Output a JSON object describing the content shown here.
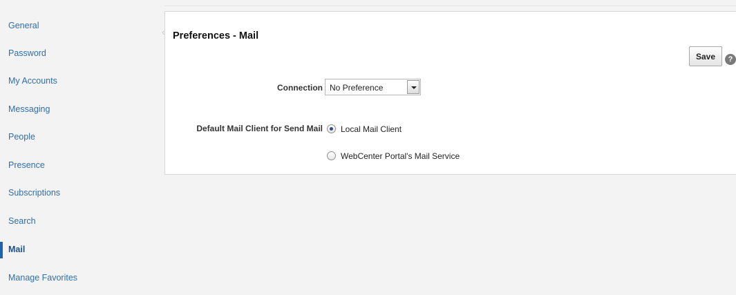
{
  "sidebar": {
    "items": [
      {
        "label": "General"
      },
      {
        "label": "Password"
      },
      {
        "label": "My Accounts"
      },
      {
        "label": "Messaging"
      },
      {
        "label": "People"
      },
      {
        "label": "Presence"
      },
      {
        "label": "Subscriptions"
      },
      {
        "label": "Search"
      },
      {
        "label": "Mail"
      },
      {
        "label": "Manage Favorites"
      }
    ],
    "active": "Mail"
  },
  "panel": {
    "title": "Preferences - Mail",
    "save_label": "Save",
    "help_icon": "help-icon",
    "collapse_icon": "chevron-left-icon"
  },
  "form": {
    "connection_label": "Connection",
    "connection_value": "No Preference",
    "mail_client_label": "Default Mail Client for Send Mail",
    "options": [
      {
        "label": "Local Mail Client",
        "checked": true
      },
      {
        "label": "WebCenter Portal's Mail Service",
        "checked": false
      }
    ]
  },
  "colors": {
    "link": "#2f6ea8",
    "active_bar": "#1d63ad",
    "background": "#f3f3f3"
  }
}
